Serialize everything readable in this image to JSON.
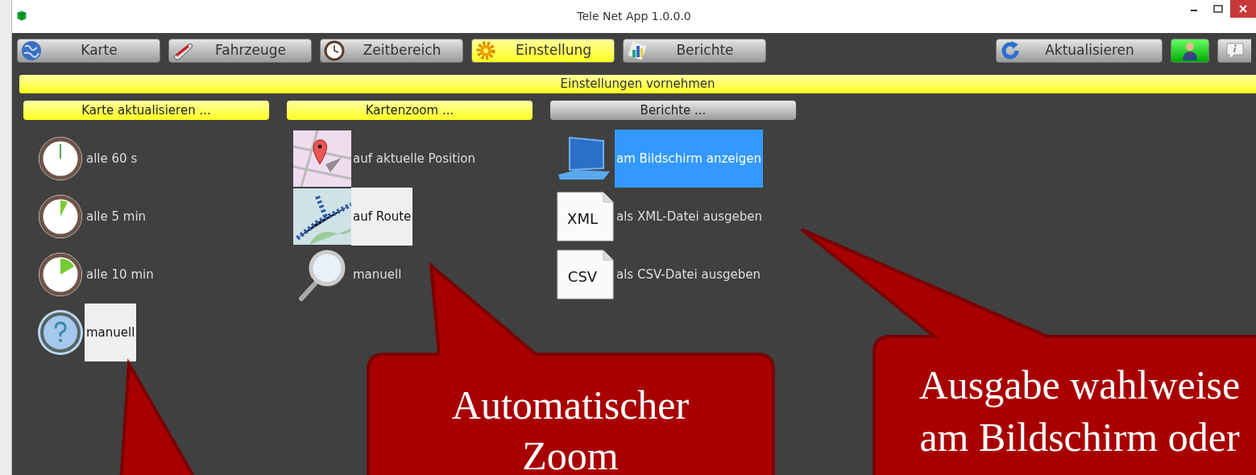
{
  "window": {
    "title": "Tele Net App 1.0.0.0"
  },
  "toolbar": {
    "tabs": [
      {
        "label": "Karte",
        "kind": "globe",
        "selected": false
      },
      {
        "label": "Fahrzeuge",
        "kind": "train",
        "selected": false
      },
      {
        "label": "Zeitbereich",
        "kind": "clock",
        "selected": false
      },
      {
        "label": "Einstellung",
        "kind": "gear",
        "selected": true
      },
      {
        "label": "Berichte",
        "kind": "chart",
        "selected": false
      }
    ],
    "refresh": {
      "label": "Aktualisieren"
    }
  },
  "banner": "Einstellungen vornehmen",
  "groups": [
    {
      "title": "Karte aktualisieren ...",
      "highlighted": true,
      "kind": "setting",
      "options": [
        {
          "label": "alle 60 s",
          "kind": "clock-hand",
          "selected": false
        },
        {
          "label": "alle 5 min",
          "kind": "clock-small",
          "selected": false
        },
        {
          "label": "alle 10 min",
          "kind": "clock-large",
          "selected": false
        },
        {
          "label": "manuell",
          "kind": "help",
          "selected": true
        }
      ]
    },
    {
      "title": "Kartenzoom ...",
      "highlighted": true,
      "kind": "setting",
      "options": [
        {
          "label": "auf aktuelle Position",
          "kind": "pin-map",
          "selected": false
        },
        {
          "label": "auf Route",
          "kind": "route-map",
          "selected": true
        },
        {
          "label": "manuell",
          "kind": "magnifier",
          "selected": false
        }
      ]
    },
    {
      "title": "Berichte ...",
      "highlighted": false,
      "kind": "output",
      "options": [
        {
          "label": "am Bildschirm anzeigen",
          "kind": "monitor",
          "selected": true
        },
        {
          "label": "als XML-Datei ausgeben",
          "kind": "file",
          "icon_text": "XML",
          "selected": false
        },
        {
          "label": "als CSV-Datei ausgeben",
          "kind": "file",
          "icon_text": "CSV",
          "selected": false
        }
      ]
    }
  ],
  "callouts": [
    {
      "kind": "pointer"
    },
    {
      "kind": "zoom",
      "lines": [
        "Automatischer",
        "Zoom"
      ]
    },
    {
      "kind": "output",
      "lines": [
        "Ausgabe wahlweise",
        "am Bildschirm oder"
      ]
    }
  ]
}
